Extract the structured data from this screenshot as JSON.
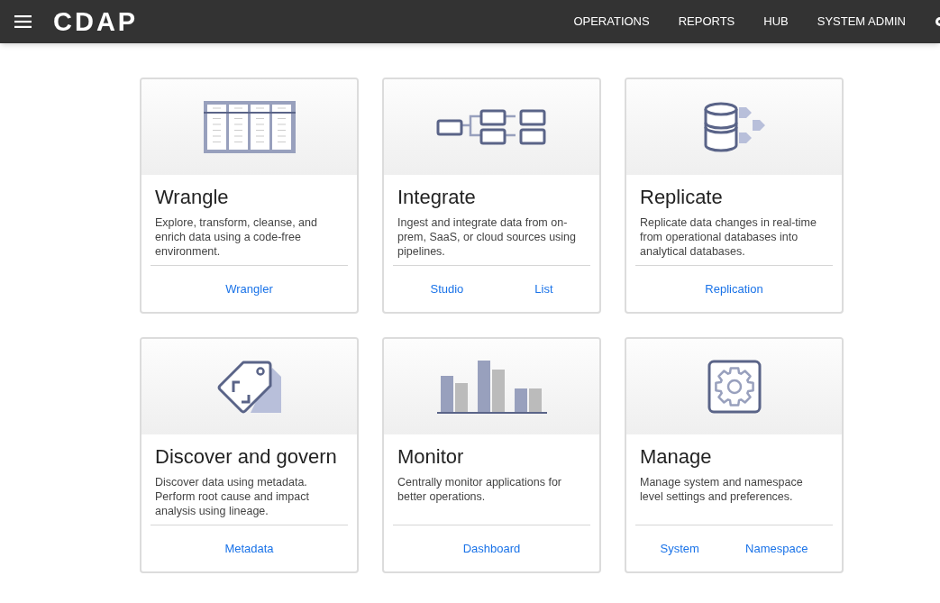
{
  "header": {
    "logo": "CDAP",
    "nav": [
      "OPERATIONS",
      "REPORTS",
      "HUB",
      "SYSTEM ADMIN"
    ]
  },
  "cards": [
    {
      "kind": "table",
      "title": "Wrangle",
      "description": "Explore, transform, cleanse, and enrich data using a code-free environment.",
      "links": [
        "Wrangler"
      ]
    },
    {
      "kind": "pipeline",
      "title": "Integrate",
      "description": "Ingest and integrate data from on-prem, SaaS, or cloud sources using pipelines.",
      "links": [
        "Studio",
        "List"
      ]
    },
    {
      "kind": "database",
      "title": "Replicate",
      "description": "Replicate data changes in real-time from operational databases into analytical databases.",
      "links": [
        "Replication"
      ]
    },
    {
      "kind": "tag",
      "title": "Discover and govern",
      "description": "Discover data using metadata. Perform root cause and impact analysis using lineage.",
      "links": [
        "Metadata"
      ]
    },
    {
      "kind": "bars",
      "title": "Monitor",
      "description": "Centrally monitor applications for better operations.",
      "links": [
        "Dashboard"
      ]
    },
    {
      "kind": "gear",
      "title": "Manage",
      "description": "Manage system and namespace level settings and preferences.",
      "links": [
        "System",
        "Namespace"
      ]
    }
  ]
}
